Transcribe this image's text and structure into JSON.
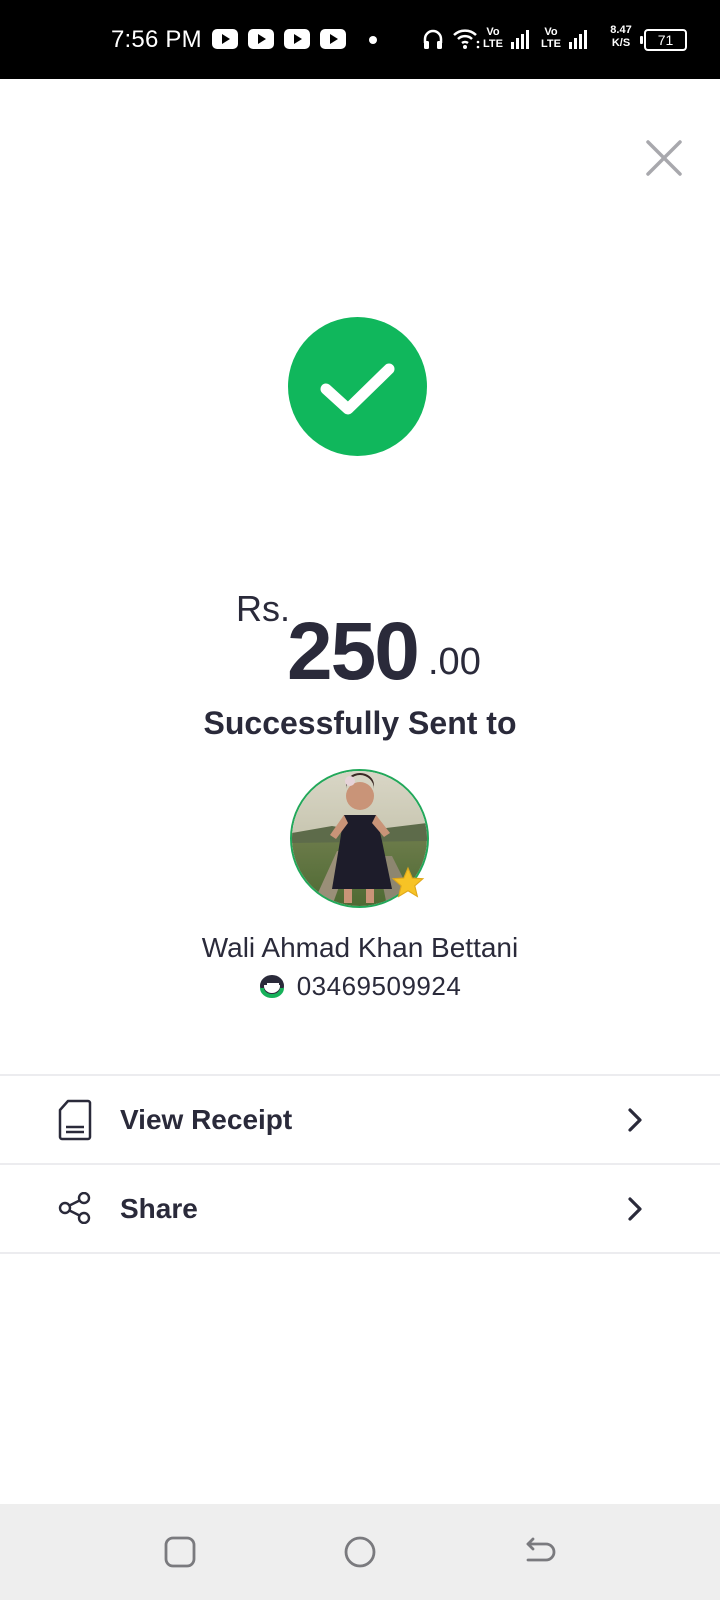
{
  "status_bar": {
    "time": "7:56 PM",
    "volte_label": "Vo\nLTE",
    "speed_value": "8.47",
    "speed_unit": "K/S",
    "battery": "71"
  },
  "close_icon": "close-icon",
  "success": {
    "icon": "checkmark-icon",
    "color": "#10b75c"
  },
  "amount": {
    "currency": "Rs.",
    "whole": "250",
    "decimal": ".00"
  },
  "sent_to_label": "Successfully Sent to",
  "recipient": {
    "name": "Wali Ahmad Khan Bettani",
    "phone": "03469509924",
    "favorite_icon": "star-icon"
  },
  "actions": [
    {
      "label": "View Receipt",
      "icon": "receipt-icon"
    },
    {
      "label": "Share",
      "icon": "share-icon"
    }
  ],
  "nav_bar": {
    "recents_icon": "recents-icon",
    "home_icon": "home-icon",
    "back_icon": "back-icon"
  }
}
